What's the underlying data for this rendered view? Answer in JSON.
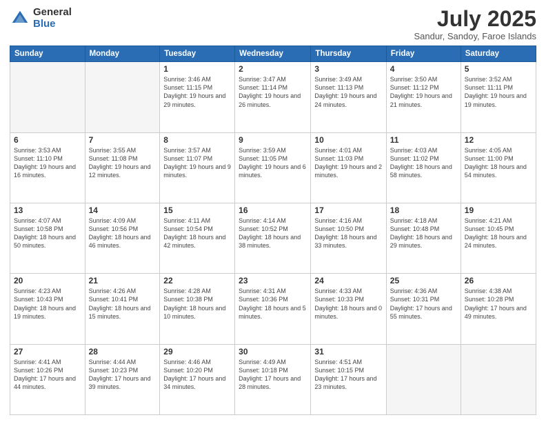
{
  "logo": {
    "general": "General",
    "blue": "Blue"
  },
  "title": "July 2025",
  "subtitle": "Sandur, Sandoy, Faroe Islands",
  "weekdays": [
    "Sunday",
    "Monday",
    "Tuesday",
    "Wednesday",
    "Thursday",
    "Friday",
    "Saturday"
  ],
  "weeks": [
    [
      {
        "day": "",
        "info": ""
      },
      {
        "day": "",
        "info": ""
      },
      {
        "day": "1",
        "info": "Sunrise: 3:46 AM\nSunset: 11:15 PM\nDaylight: 19 hours and 29 minutes."
      },
      {
        "day": "2",
        "info": "Sunrise: 3:47 AM\nSunset: 11:14 PM\nDaylight: 19 hours and 26 minutes."
      },
      {
        "day": "3",
        "info": "Sunrise: 3:49 AM\nSunset: 11:13 PM\nDaylight: 19 hours and 24 minutes."
      },
      {
        "day": "4",
        "info": "Sunrise: 3:50 AM\nSunset: 11:12 PM\nDaylight: 19 hours and 21 minutes."
      },
      {
        "day": "5",
        "info": "Sunrise: 3:52 AM\nSunset: 11:11 PM\nDaylight: 19 hours and 19 minutes."
      }
    ],
    [
      {
        "day": "6",
        "info": "Sunrise: 3:53 AM\nSunset: 11:10 PM\nDaylight: 19 hours and 16 minutes."
      },
      {
        "day": "7",
        "info": "Sunrise: 3:55 AM\nSunset: 11:08 PM\nDaylight: 19 hours and 12 minutes."
      },
      {
        "day": "8",
        "info": "Sunrise: 3:57 AM\nSunset: 11:07 PM\nDaylight: 19 hours and 9 minutes."
      },
      {
        "day": "9",
        "info": "Sunrise: 3:59 AM\nSunset: 11:05 PM\nDaylight: 19 hours and 6 minutes."
      },
      {
        "day": "10",
        "info": "Sunrise: 4:01 AM\nSunset: 11:03 PM\nDaylight: 19 hours and 2 minutes."
      },
      {
        "day": "11",
        "info": "Sunrise: 4:03 AM\nSunset: 11:02 PM\nDaylight: 18 hours and 58 minutes."
      },
      {
        "day": "12",
        "info": "Sunrise: 4:05 AM\nSunset: 11:00 PM\nDaylight: 18 hours and 54 minutes."
      }
    ],
    [
      {
        "day": "13",
        "info": "Sunrise: 4:07 AM\nSunset: 10:58 PM\nDaylight: 18 hours and 50 minutes."
      },
      {
        "day": "14",
        "info": "Sunrise: 4:09 AM\nSunset: 10:56 PM\nDaylight: 18 hours and 46 minutes."
      },
      {
        "day": "15",
        "info": "Sunrise: 4:11 AM\nSunset: 10:54 PM\nDaylight: 18 hours and 42 minutes."
      },
      {
        "day": "16",
        "info": "Sunrise: 4:14 AM\nSunset: 10:52 PM\nDaylight: 18 hours and 38 minutes."
      },
      {
        "day": "17",
        "info": "Sunrise: 4:16 AM\nSunset: 10:50 PM\nDaylight: 18 hours and 33 minutes."
      },
      {
        "day": "18",
        "info": "Sunrise: 4:18 AM\nSunset: 10:48 PM\nDaylight: 18 hours and 29 minutes."
      },
      {
        "day": "19",
        "info": "Sunrise: 4:21 AM\nSunset: 10:45 PM\nDaylight: 18 hours and 24 minutes."
      }
    ],
    [
      {
        "day": "20",
        "info": "Sunrise: 4:23 AM\nSunset: 10:43 PM\nDaylight: 18 hours and 19 minutes."
      },
      {
        "day": "21",
        "info": "Sunrise: 4:26 AM\nSunset: 10:41 PM\nDaylight: 18 hours and 15 minutes."
      },
      {
        "day": "22",
        "info": "Sunrise: 4:28 AM\nSunset: 10:38 PM\nDaylight: 18 hours and 10 minutes."
      },
      {
        "day": "23",
        "info": "Sunrise: 4:31 AM\nSunset: 10:36 PM\nDaylight: 18 hours and 5 minutes."
      },
      {
        "day": "24",
        "info": "Sunrise: 4:33 AM\nSunset: 10:33 PM\nDaylight: 18 hours and 0 minutes."
      },
      {
        "day": "25",
        "info": "Sunrise: 4:36 AM\nSunset: 10:31 PM\nDaylight: 17 hours and 55 minutes."
      },
      {
        "day": "26",
        "info": "Sunrise: 4:38 AM\nSunset: 10:28 PM\nDaylight: 17 hours and 49 minutes."
      }
    ],
    [
      {
        "day": "27",
        "info": "Sunrise: 4:41 AM\nSunset: 10:26 PM\nDaylight: 17 hours and 44 minutes."
      },
      {
        "day": "28",
        "info": "Sunrise: 4:44 AM\nSunset: 10:23 PM\nDaylight: 17 hours and 39 minutes."
      },
      {
        "day": "29",
        "info": "Sunrise: 4:46 AM\nSunset: 10:20 PM\nDaylight: 17 hours and 34 minutes."
      },
      {
        "day": "30",
        "info": "Sunrise: 4:49 AM\nSunset: 10:18 PM\nDaylight: 17 hours and 28 minutes."
      },
      {
        "day": "31",
        "info": "Sunrise: 4:51 AM\nSunset: 10:15 PM\nDaylight: 17 hours and 23 minutes."
      },
      {
        "day": "",
        "info": ""
      },
      {
        "day": "",
        "info": ""
      }
    ]
  ]
}
